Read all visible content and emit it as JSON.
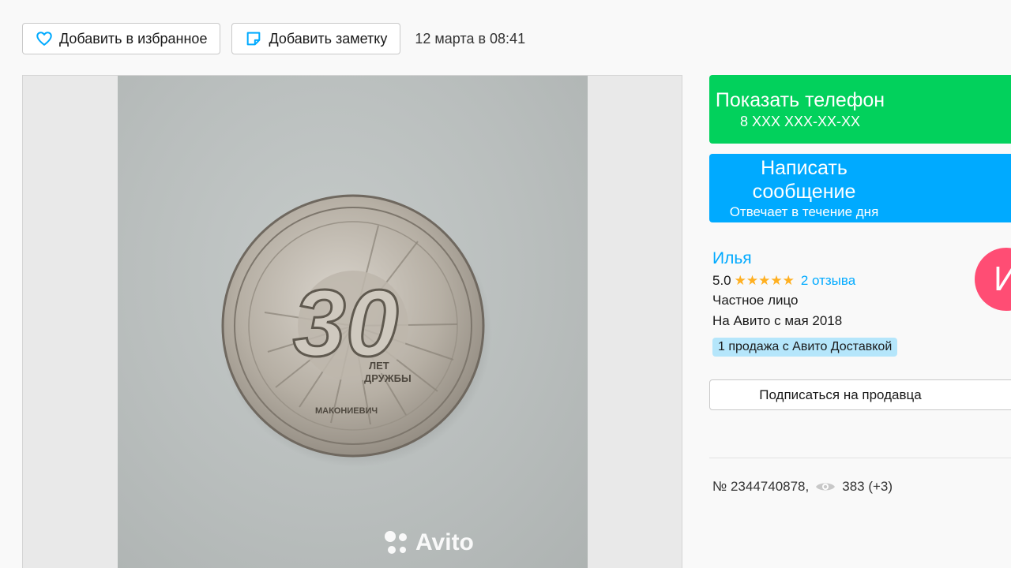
{
  "actions": {
    "favorite_label": "Добавить в избранное",
    "note_label": "Добавить заметку",
    "date": "12 марта в 08:41"
  },
  "gallery": {
    "watermark": "Avito",
    "coin_text": {
      "big_number": "30",
      "inner_line1": "ЛЕТ",
      "inner_line2": "ДРУЖБЫ",
      "bottom_text": "МАКОНИЕВИЧ"
    }
  },
  "contact": {
    "phone_label": "Показать телефон",
    "phone_number": "8 XXX XXX-XX-XX",
    "message_label": "Написать сообщение",
    "message_sub": "Отвечает в течение дня"
  },
  "seller": {
    "name": "Илья",
    "rating": "5.0",
    "stars": "★★★★★",
    "reviews": "2 отзыва",
    "type": "Частное лицо",
    "since": "На Авито с мая 2018",
    "badge": "1 продажа с Авито Доставкой",
    "avatar_letter": "И",
    "subscribe_label": "Подписаться на продавца"
  },
  "listing": {
    "number": "№ 2344740878,",
    "views": "383 (+3)"
  },
  "colors": {
    "green": "#02d15c",
    "blue": "#00aaff",
    "avatar": "#ff4d74",
    "star": "#ffb021",
    "badge": "#b5e6fb"
  },
  "icons": {
    "favorite": "heart-icon",
    "note": "note-icon",
    "views": "eye-icon",
    "watermark": "avito-logo-icon"
  }
}
